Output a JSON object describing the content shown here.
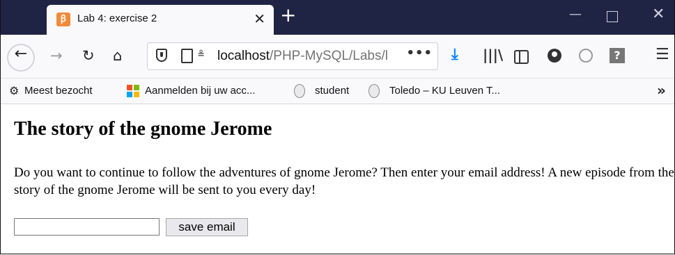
{
  "window": {
    "tab_title": "Lab 4: exercise 2",
    "new_tab_symbol": "+",
    "close_tab_symbol": "✕"
  },
  "toolbar": {
    "url_host": "localhost",
    "url_path": "/PHP-MySQL/Labs/l",
    "url_more": "•••"
  },
  "bookmarks": [
    {
      "label": "Meest bezocht",
      "icon": "gear-icon"
    },
    {
      "label": "Aanmelden bij uw acc...",
      "icon": "microsoft-logo-icon"
    },
    {
      "label": "student",
      "icon": "ku-leuven-seal-icon"
    },
    {
      "label": "Toledo – KU Leuven T...",
      "icon": "ku-leuven-seal-icon"
    }
  ],
  "page": {
    "heading": "The story of the gnome Jerome",
    "paragraph": "Do you want to continue to follow the adventures of gnome Jerome? Then enter your email address! A new episode from the story of the gnome Jerome will be sent to you every day!",
    "email_value": "",
    "save_button": "save email"
  },
  "colors": {
    "tabbar_bg": "#1f2445",
    "favicon": "#f18b3a",
    "download_blue": "#0a84ff"
  }
}
